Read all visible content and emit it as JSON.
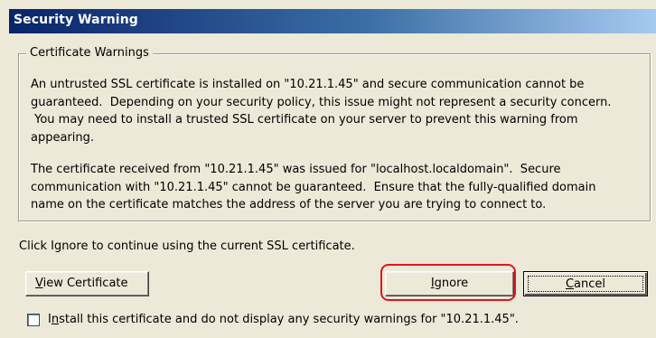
{
  "window": {
    "title": "Security Warning"
  },
  "group": {
    "legend": "Certificate Warnings",
    "paragraph1": "An untrusted SSL certificate is installed on \"10.21.1.45\" and secure communication cannot be\nguaranteed.  Depending on your security policy, this issue might not represent a security concern.\n You may need to install a trusted SSL certificate on your server to prevent this warning from\nappearing.",
    "paragraph2": "The certificate received from \"10.21.1.45\" was issued for \"localhost.localdomain\".  Secure\ncommunication with \"10.21.1.45\" cannot be guaranteed.  Ensure that the fully-qualified domain\nname on the certificate matches the address of the server you are trying to connect to."
  },
  "note": "Click Ignore to continue using the current SSL certificate.",
  "buttons": {
    "view_certificate": {
      "mnemonic": "V",
      "rest": "iew Certificate"
    },
    "ignore": {
      "mnemonic": "I",
      "rest": "gnore"
    },
    "cancel": {
      "mnemonic": "C",
      "rest": "ancel"
    }
  },
  "checkbox": {
    "checked": false,
    "label_first": "I",
    "label_mnemonic": "n",
    "label_rest": "stall this certificate and do not display any security warnings for \"10.21.1.45\"."
  },
  "annotation": {
    "highlight_color": "#e0161d"
  }
}
